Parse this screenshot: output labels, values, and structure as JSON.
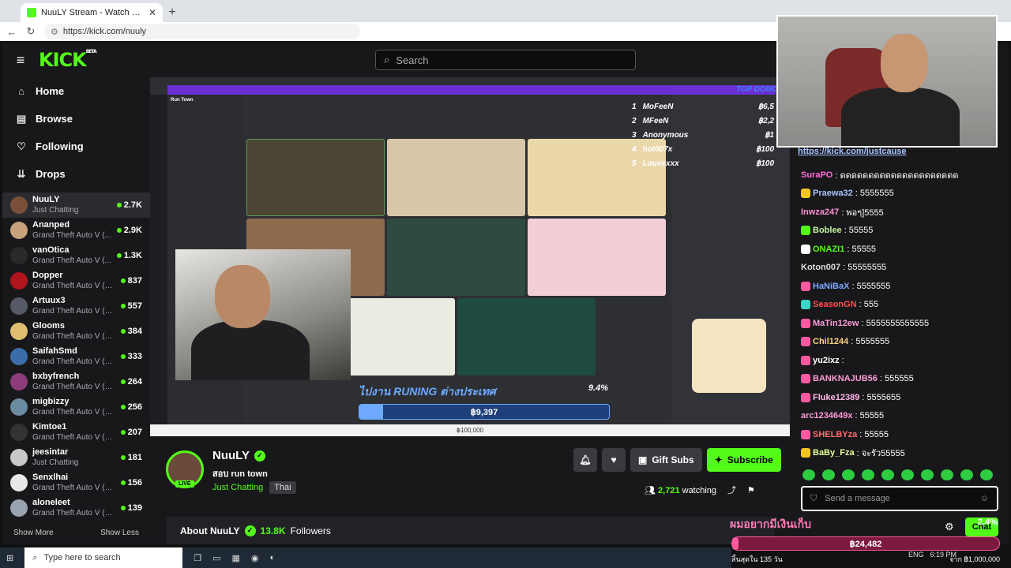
{
  "browser": {
    "tab_title": "NuuLY Stream - Watch Live on Kick",
    "url": "https://kick.com/nuuly"
  },
  "header": {
    "logo": "KICK",
    "logo_beta": "BETA",
    "search_placeholder": "Search"
  },
  "nav": [
    {
      "label": "Home",
      "icon": "home-icon"
    },
    {
      "label": "Browse",
      "icon": "browse-icon"
    },
    {
      "label": "Following",
      "icon": "heart-icon"
    },
    {
      "label": "Drops",
      "icon": "drops-icon"
    }
  ],
  "channels": [
    {
      "name": "NuuLY",
      "category": "Just Chatting",
      "viewers": "2.7K",
      "color": "#7a4f3a"
    },
    {
      "name": "Ananped",
      "category": "Grand Theft Auto V (...",
      "viewers": "2.9K",
      "color": "#c7a27c"
    },
    {
      "name": "vanOtica",
      "category": "Grand Theft Auto V (...",
      "viewers": "1.3K",
      "color": "#2a2a2a"
    },
    {
      "name": "Dopper",
      "category": "Grand Theft Auto V (G...",
      "viewers": "837",
      "color": "#b0141c"
    },
    {
      "name": "Artuux3",
      "category": "Grand Theft Auto V (G...",
      "viewers": "557",
      "color": "#555a66"
    },
    {
      "name": "Glooms",
      "category": "Grand Theft Auto V (G...",
      "viewers": "384",
      "color": "#e0c070"
    },
    {
      "name": "SaifahSmd",
      "category": "Grand Theft Auto V (G...",
      "viewers": "333",
      "color": "#3b6ea8"
    },
    {
      "name": "bxbyfrench",
      "category": "Grand Theft Auto V (G...",
      "viewers": "264",
      "color": "#8c3c78"
    },
    {
      "name": "migbizzy",
      "category": "Grand Theft Auto V (G...",
      "viewers": "256",
      "color": "#6c8aa0"
    },
    {
      "name": "Kimtoe1",
      "category": "Grand Theft Auto V (G...",
      "viewers": "207",
      "color": "#333"
    },
    {
      "name": "jeesintar",
      "category": "Just Chatting",
      "viewers": "181",
      "color": "#c9c9c9"
    },
    {
      "name": "Senxlhai",
      "category": "Grand Theft Auto V (G...",
      "viewers": "156",
      "color": "#e8e8e8"
    },
    {
      "name": "aloneleet",
      "category": "Grand Theft Auto V (G...",
      "viewers": "139",
      "color": "#9aa4b0"
    }
  ],
  "sidebar_footer": {
    "show_more": "Show More",
    "show_less": "Show Less"
  },
  "stream_overlay": {
    "discord_server": "Run Town",
    "donors_title": "TOP DONO",
    "donors": [
      {
        "rank": "1",
        "name": "MoFeeN",
        "amount": "฿6,5"
      },
      {
        "rank": "2",
        "name": "MFeeN",
        "amount": "฿2,2"
      },
      {
        "rank": "3",
        "name": "Anonymous",
        "amount": "฿1"
      },
      {
        "rank": "4",
        "name": "hot007x",
        "amount": "฿100"
      },
      {
        "rank": "5",
        "name": "Louvexxx",
        "amount": "฿100"
      }
    ],
    "goal_title": "ไปงาน RUNING ต่างประเทศ",
    "goal_percent": "9.4%",
    "goal_fraction": 0.094,
    "goal_amount": "฿9,397",
    "goal_target": "฿100,000"
  },
  "streamer": {
    "name": "NuuLY",
    "title": "สอบ run town",
    "category": "Just Chatting",
    "language": "Thai",
    "live": "LIVE",
    "watching_count": "2,721",
    "watching_label": "watching",
    "gift_subs": "Gift Subs",
    "subscribe": "Subscribe",
    "about": "About NuuLY",
    "followers_count": "13.8K",
    "followers_label": "Followers"
  },
  "chat": {
    "pinned_link": "https://kick.com/justcause",
    "messages": [
      {
        "user": "SuraPO",
        "text": ": ดดดดดดดดดดดดดดดดดดดดด",
        "color": "#ff6bd6",
        "badge": ""
      },
      {
        "user": "Praewa32",
        "text": ": 5555555",
        "color": "#aac4ff",
        "badge": "#f3c623"
      },
      {
        "user": "Inwza247",
        "text": ": พอๆ]5555",
        "color": "#ff8fd0",
        "badge": ""
      },
      {
        "user": "Boblee",
        "text": ": 55555",
        "color": "#c4f3a1",
        "badge": "#53fc18"
      },
      {
        "user": "ONAZI1",
        "text": ": 55555",
        "color": "#53fc18",
        "badge": "#ffffff"
      },
      {
        "user": "Koton007",
        "text": ": 55555555",
        "color": "#dddddd",
        "badge": ""
      },
      {
        "user": "HaNiBaX",
        "text": ": 5555555",
        "color": "#7fa8ff",
        "badge": "#ff5aa0"
      },
      {
        "user": "SeasonGN",
        "text": ": 555",
        "color": "#ff4f4f",
        "badge": "#3ad6c8"
      },
      {
        "user": "MaTin12ew",
        "text": ": 5555555555555",
        "color": "#ff9cd9",
        "badge": "#ff5aa0"
      },
      {
        "user": "Chil1244",
        "text": ": 5555555",
        "color": "#ffd27f",
        "badge": "#ff5aa0"
      },
      {
        "user": "yu2ixz",
        "text": ":",
        "color": "#ffffff",
        "badge": "#ff5aa0"
      },
      {
        "user": "BANKNAJUB56",
        "text": ": 555555",
        "color": "#ff9cd9",
        "badge": "#ff5aa0"
      },
      {
        "user": "Fluke12389",
        "text": ": 5555655",
        "color": "#ffb8e8",
        "badge": "#ff5aa0"
      },
      {
        "user": "arc1234649x",
        "text": ": 55555",
        "color": "#ff9cd9",
        "badge": ""
      },
      {
        "user": "SHELBYza",
        "text": ": 55555",
        "color": "#ff6b6b",
        "badge": "#ff5aa0"
      },
      {
        "user": "BaBy_Fza",
        "text": ": จะรัว55555",
        "color": "#e8ff9a",
        "badge": "#f3c623"
      }
    ],
    "input_placeholder": "Send a message",
    "send": "Chat"
  },
  "chat_goal": {
    "title": "ผมอยากมีเงินเก็บ",
    "percent": "2.4%",
    "amount": "฿24,482",
    "days": "สิ้นสุดใน 135 วัน",
    "target": "จาก ฿1,000,000"
  },
  "taskbar": {
    "search": "Type here to search",
    "lang": "ENG",
    "time": "6:19 PM"
  }
}
